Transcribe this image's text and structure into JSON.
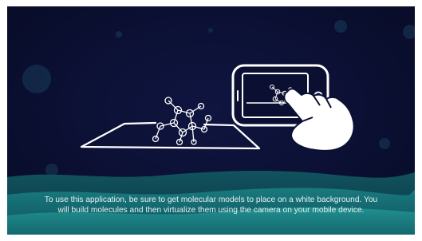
{
  "instructions": {
    "line1": "To use this application, be sure to get molecular models to place on a white background. You",
    "line2": "will build molecules and then virtualize them using the camera on your mobile device."
  },
  "colors": {
    "background": "#0b1033",
    "wave_dark": "#0c3b4a",
    "wave_mid": "#12626a",
    "wave_light": "#1e8a8a",
    "line_art": "#ffffff",
    "text": "#e6f2f2"
  },
  "icons": {
    "molecule": "molecule-icon",
    "phone": "phone-icon",
    "hand": "pointing-hand-icon",
    "surface": "white-surface-icon"
  }
}
